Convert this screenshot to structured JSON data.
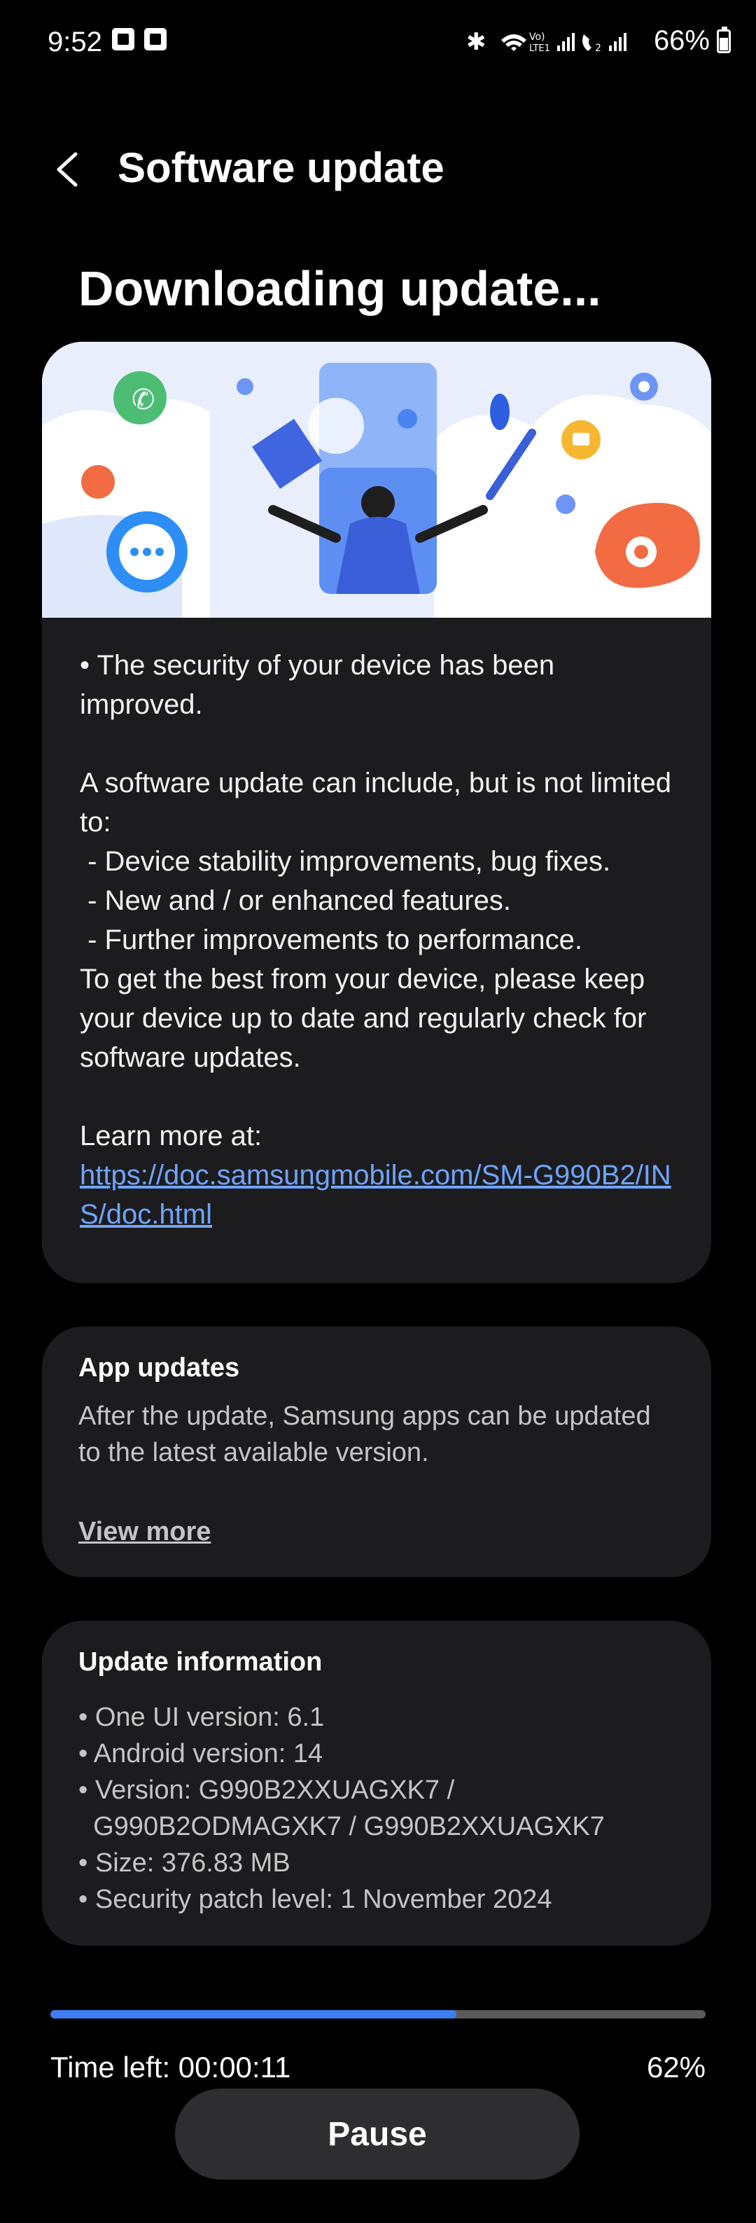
{
  "status_bar": {
    "time": "9:52",
    "battery": "66%",
    "battery_level": 0.66
  },
  "header": {
    "title": "Software update",
    "back_icon": "chevron-left-icon"
  },
  "main": {
    "heading": "Downloading update...",
    "release_notes": {
      "lines": [
        "• The security of your device has been improved.",
        "",
        "A software update can include, but is not limited to:",
        " - Device stability improvements, bug fixes.",
        " - New and / or enhanced features.",
        " - Further improvements to performance.",
        "To get the best from your device, please keep your device up to date and regularly check for software updates.",
        "",
        "Learn more at:"
      ],
      "link": "https://doc.samsungmobile.com/SM-G990B2/INS/doc.html"
    }
  },
  "app_updates": {
    "title": "App updates",
    "body": "After the update, Samsung apps can be updated to the latest available version.",
    "view_more": "View more"
  },
  "update_info": {
    "title": "Update information",
    "items": [
      "• One UI version: 6.1",
      "• Android version: 14",
      "• Version: G990B2XXUAGXK7 /",
      "  G990B2ODMAGXK7 / G990B2XXUAGXK7",
      "• Size: 376.83 MB",
      "• Security patch level: 1 November 2024"
    ]
  },
  "progress": {
    "fraction": 0.62,
    "time_left": "Time left: 00:00:11",
    "percent": "62%"
  },
  "actions": {
    "pause": "Pause"
  },
  "colors": {
    "background": "#000000",
    "card": "#1c1c1e",
    "accent": "#3f7ef2",
    "link": "#6fa4ff"
  }
}
